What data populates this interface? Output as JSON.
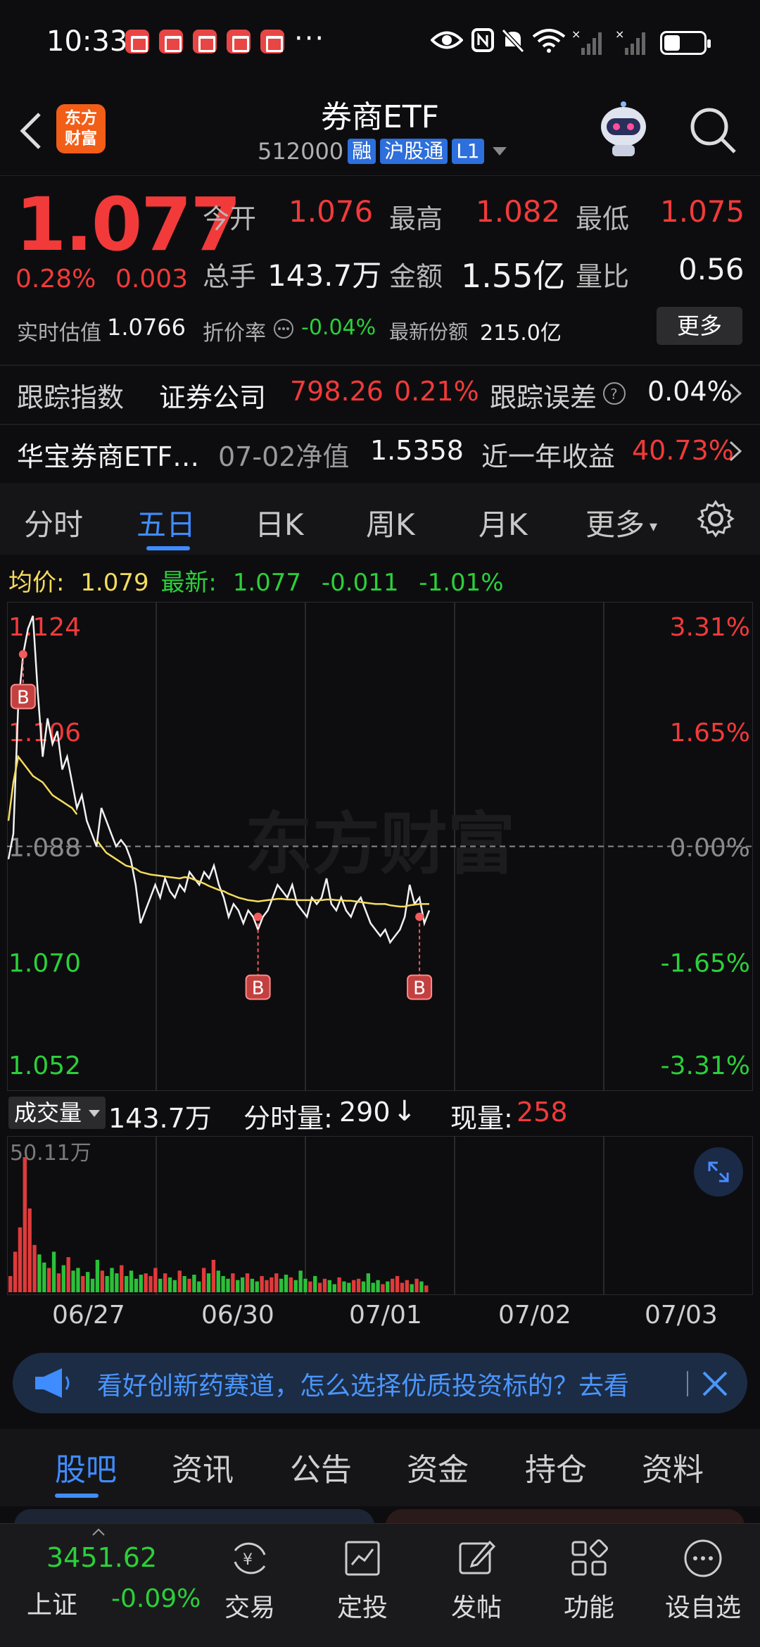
{
  "status": {
    "time": "10:33",
    "more": "···"
  },
  "header": {
    "title": "券商ETF",
    "code": "512000",
    "tags": [
      "融",
      "沪股通",
      "L1"
    ],
    "logo": [
      "东方",
      "财富"
    ]
  },
  "quote": {
    "price": "1.077",
    "pct": "0.28%",
    "change": "0.003",
    "open_label": "今开",
    "open": "1.076",
    "high_label": "最高",
    "high": "1.082",
    "low_label": "最低",
    "low": "1.075",
    "vol_label": "总手",
    "vol": "143.7万",
    "amount_label": "金额",
    "amount": "1.55亿",
    "ratio_label": "量比",
    "ratio": "0.56",
    "iopv_label": "实时估值",
    "iopv": "1.0766",
    "discount_label": "折价率",
    "discount": "-0.04%",
    "shares_label": "最新份额",
    "shares": "215.0亿",
    "more": "更多"
  },
  "tracking": {
    "label": "跟踪指数",
    "index": "证券公司",
    "index_val": "798.26",
    "index_pct": "0.21%",
    "err_label": "跟踪误差",
    "err_val": "0.04%"
  },
  "fund": {
    "name": "华宝券商ETF…",
    "nav_label": "07-02净值",
    "nav": "1.5358",
    "ret_label": "近一年收益",
    "ret": "40.73%"
  },
  "chart_tabs": [
    "分时",
    "五日",
    "日K",
    "周K",
    "月K",
    "更多"
  ],
  "avg_bar": {
    "avg_label": "均价:",
    "avg": "1.079",
    "last_label": "最新:",
    "last": "1.077",
    "chg": "-0.011",
    "pct": "-1.01%"
  },
  "watermark": "东方财富",
  "chart_data": {
    "type": "line",
    "title": "",
    "x": [
      "06/27",
      "06/30",
      "07/01",
      "07/02",
      "07/03"
    ],
    "y_left_ticks": [
      "1.124",
      "1.106",
      "1.088",
      "1.070",
      "1.052"
    ],
    "y_right_ticks": [
      "3.31%",
      "1.65%",
      "0.00%",
      "-1.65%",
      "-3.31%"
    ],
    "ylim": [
      1.052,
      1.124
    ],
    "prev_close": 1.088,
    "series": [
      {
        "values": [
          1.086,
          1.09,
          1.11,
          1.118,
          1.122,
          1.124,
          1.112,
          1.102,
          1.108,
          1.104,
          1.106,
          1.1,
          1.102,
          1.098,
          1.094,
          1.096,
          1.092,
          1.09,
          1.088,
          1.094,
          1.092,
          1.09,
          1.088,
          1.089,
          1.088,
          1.086,
          1.082,
          1.076,
          1.078,
          1.08,
          1.082,
          1.08,
          1.083,
          1.081,
          1.08,
          1.082,
          1.081,
          1.084,
          1.083,
          1.082,
          1.084,
          1.083,
          1.085,
          1.082,
          1.08,
          1.077,
          1.079,
          1.078,
          1.076,
          1.078,
          1.077,
          1.075,
          1.077,
          1.078,
          1.08,
          1.082,
          1.081,
          1.08,
          1.082,
          1.079,
          1.078,
          1.077,
          1.08,
          1.079,
          1.08,
          1.083,
          1.079,
          1.078,
          1.08,
          1.078,
          1.077,
          1.079,
          1.08,
          1.078,
          1.076,
          1.075,
          1.074,
          1.075,
          1.073,
          1.074,
          1.075,
          1.077,
          1.082,
          1.079,
          1.08,
          1.076,
          1.078
        ]
      },
      {
        "values": [
          1.092,
          1.098,
          1.102,
          1.101,
          1.1,
          1.099,
          1.0985,
          1.098,
          1.097,
          1.096,
          1.0955,
          1.095,
          1.0945,
          1.094,
          1.093,
          null,
          null,
          null,
          1.089,
          1.088,
          1.087,
          1.0865,
          1.086,
          1.0855,
          1.085,
          1.0848,
          1.0845,
          1.084,
          1.0838,
          1.0836,
          1.0835,
          1.0834,
          1.0833,
          1.0832,
          1.0831,
          1.083,
          1.0832,
          1.0831,
          1.0828,
          1.0825,
          1.0822,
          1.0818,
          1.0815,
          1.0812,
          1.081,
          1.0806,
          1.0803,
          1.08,
          1.0798,
          1.0796,
          1.0795,
          1.0794,
          1.0795,
          1.0796,
          1.0797,
          1.0798,
          1.0798,
          1.0797,
          1.0797,
          1.0796,
          1.0796,
          1.0796,
          1.0796,
          1.0796,
          1.0796,
          1.0797,
          1.0797,
          1.0796,
          1.0796,
          1.0795,
          1.0795,
          1.0794,
          1.0793,
          1.0792,
          1.0791,
          1.079,
          1.079,
          1.079,
          1.0788,
          1.0787,
          1.0786,
          1.0786,
          1.0788,
          1.0789,
          1.079,
          1.079,
          1.079
        ]
      }
    ],
    "markers": [
      {
        "label": "B",
        "x_index": 3,
        "y": 1.118
      },
      {
        "label": "B",
        "x_index": 51,
        "y": 1.077
      },
      {
        "label": "B",
        "x_index": 84,
        "y": 1.077
      }
    ],
    "volume": {
      "head_select": "成交量",
      "total": "143.7万",
      "bar_label": "分时量:",
      "bar_val": "290",
      "arrow": "↓",
      "now_label": "现量:",
      "now_val": "258",
      "max_label": "50.11万",
      "values": [
        12,
        30,
        48,
        100,
        62,
        35,
        28,
        22,
        18,
        30,
        14,
        20,
        26,
        16,
        18,
        12,
        15,
        10,
        24,
        16,
        12,
        18,
        14,
        20,
        12,
        16,
        10,
        13,
        14,
        12,
        18,
        10,
        14,
        11,
        9,
        16,
        12,
        10,
        13,
        8,
        18,
        14,
        24,
        16,
        12,
        10,
        14,
        9,
        11,
        14,
        10,
        8,
        12,
        9,
        11,
        14,
        10,
        13,
        11,
        9,
        16,
        10,
        8,
        12,
        7,
        10,
        9,
        6,
        11,
        8,
        7,
        9,
        10,
        8,
        14,
        7,
        9,
        6,
        8,
        10,
        12,
        7,
        9,
        6,
        10,
        8,
        5
      ]
    }
  },
  "banner": {
    "text": "看好创新药赛道，怎么选择优质投资标的？去看"
  },
  "info_tabs": [
    "股吧",
    "资讯",
    "公告",
    "资金",
    "持仓",
    "资料"
  ],
  "bottom": {
    "index_val": "3451.62",
    "index_name": "上证",
    "index_pct": "-0.09%",
    "nav": [
      "交易",
      "定投",
      "发帖",
      "功能",
      "设自选"
    ]
  },
  "colors": {
    "up": "#f23a3a",
    "down": "#2bd03a",
    "accent": "#3f8cff",
    "avg": "#f4dc5c"
  }
}
